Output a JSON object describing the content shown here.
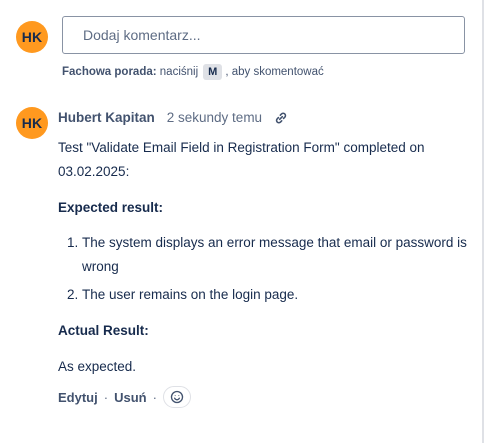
{
  "composer": {
    "avatar_initials": "HK",
    "placeholder": "Dodaj komentarz...",
    "tip_label": "Fachowa porada:",
    "tip_press": "naciśnij",
    "tip_key": "M",
    "tip_suffix": ", aby skomentować"
  },
  "comment": {
    "avatar_initials": "HK",
    "author": "Hubert Kapitan",
    "timestamp": "2 sekundy temu",
    "intro": "Test \"Validate Email Field in Registration Form\" completed on 03.02.2025:",
    "expected_heading": "Expected result:",
    "expected_items": [
      "The system displays an error message that email or password is wrong",
      "The user remains on the login page."
    ],
    "actual_heading": "Actual Result:",
    "actual_text": "As expected.",
    "actions": {
      "edit": "Edytuj",
      "separator": "·",
      "delete": "Usuń"
    }
  },
  "colors": {
    "avatar_bg": "#ff991f",
    "text_primary": "#172b4d",
    "text_secondary": "#5e6c84",
    "input_border": "#8993a4"
  },
  "icons": {
    "permalink": "link-icon",
    "reaction": "emoji-smile-icon"
  }
}
